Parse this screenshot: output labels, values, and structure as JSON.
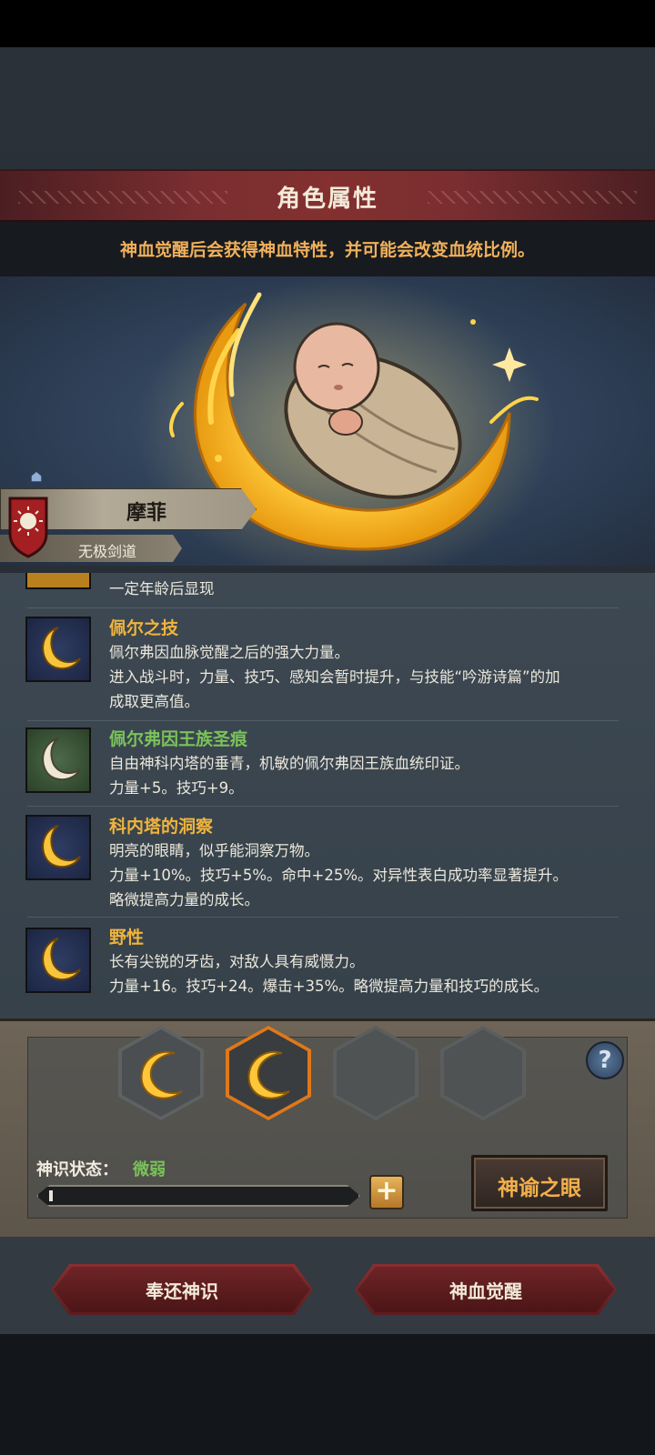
{
  "header": {
    "title": "角色属性",
    "subtitle": "神血觉醒后会获得神血特性，并可能会改变血统比例。"
  },
  "character": {
    "name": "摩菲",
    "sect": "无极剑道",
    "portrait_icon": "swaddled-baby-on-crescent-moon"
  },
  "traits": {
    "partial_desc": "一定年龄后显现",
    "items": [
      {
        "name": "佩尔之技",
        "color": "#f0b43d",
        "icon": "golden-crescent-icon",
        "lines": [
          "佩尔弗因血脉觉醒之后的强大力量。",
          "进入战斗时，力量、技巧、感知会暂时提升，与技能“吟游诗篇”的加",
          "成取更高值。"
        ]
      },
      {
        "name": "佩尔弗因王族圣痕",
        "color": "#7ac25a",
        "icon": "white-crescent-icon",
        "lines": [
          "自由神科内塔的垂青，机敏的佩尔弗因王族血统印证。",
          "力量+5。技巧+9。"
        ]
      },
      {
        "name": "科内塔的洞察",
        "color": "#f0b43d",
        "icon": "golden-crescent-icon",
        "lines": [
          "明亮的眼睛，似乎能洞察万物。",
          "力量+10%。技巧+5%。命中+25%。对异性表白成功率显著提升。",
          "略微提高力量的成长。"
        ]
      },
      {
        "name": "野性",
        "color": "#f0b43d",
        "icon": "golden-crescent-icon",
        "lines": [
          "长有尖锐的牙齿，对敌人具有威慑力。",
          "力量+16。技巧+24。爆击+35%。略微提高力量和技巧的成长。"
        ]
      }
    ]
  },
  "panel": {
    "help_label": "?",
    "status_label": "神识状态：",
    "status_value": "微弱",
    "progress": 0.01,
    "plus_label": "+",
    "oracle_button": "神谕之眼"
  },
  "footer": {
    "return_button": "奉还神识",
    "awaken_button": "神血觉醒"
  },
  "colors": {
    "accent_gold": "#f0b43d",
    "accent_green": "#7ac25a",
    "banner_red": "#7a2e30",
    "selected_orange": "#e07818"
  }
}
